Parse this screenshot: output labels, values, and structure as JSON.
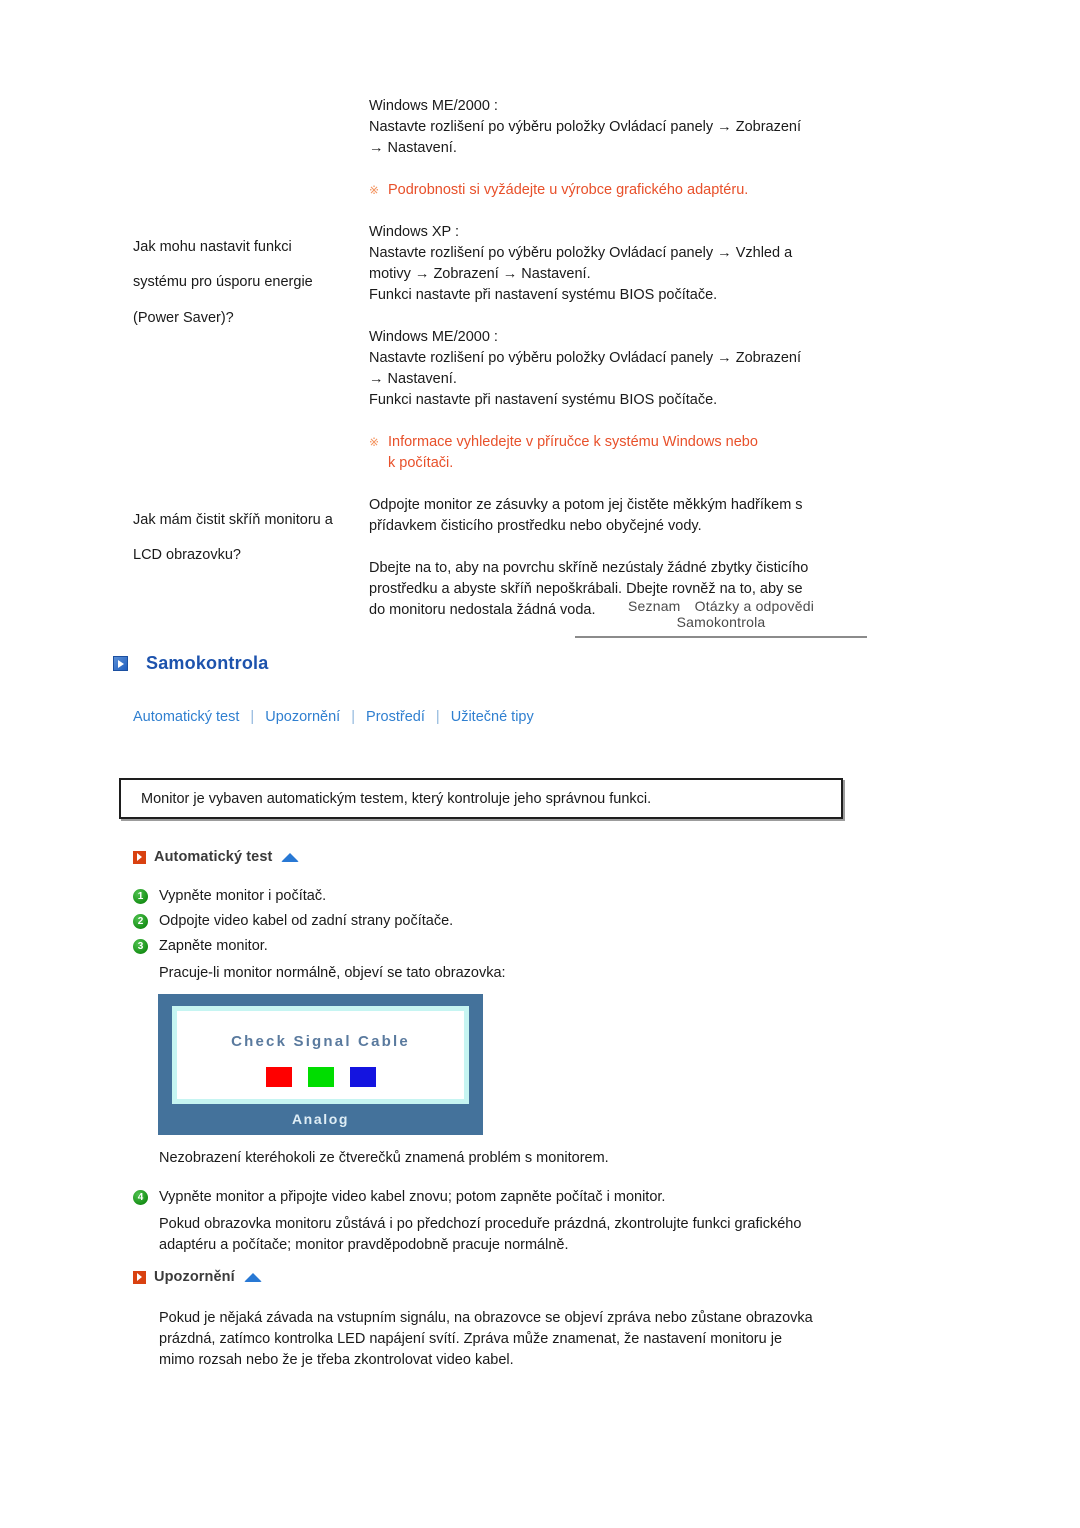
{
  "faq": {
    "rows": [
      {
        "question": "",
        "answer_blocks": [
          {
            "type": "text",
            "lines": [
              "Windows ME/2000 :",
              "Nastavte rozlišení po výběru položky Ovládací panely → Zobrazení",
              "→ Nastavení."
            ]
          },
          {
            "type": "note",
            "mark": "※",
            "lines": [
              "Podrobnosti si vyžádejte u výrobce grafického adaptéru."
            ]
          }
        ]
      },
      {
        "question": "Jak mohu nastavit funkci systému pro úsporu energie (Power Saver)?",
        "question_lines": [
          "Jak mohu nastavit funkci",
          "systému pro úsporu energie",
          "(Power Saver)?"
        ],
        "answer_blocks": [
          {
            "type": "text",
            "lines": [
              "Windows XP :",
              "Nastavte rozlišení po výběru položky Ovládací panely → Vzhled a",
              "motivy → Zobrazení → Nastavení.",
              "Funkci nastavte při nastavení systému BIOS počítače."
            ]
          },
          {
            "type": "text",
            "lines": [
              "Windows ME/2000 :",
              "Nastavte rozlišení po výběru položky Ovládací panely → Zobrazení",
              "→ Nastavení.",
              "Funkci nastavte při nastavení systému BIOS počítače."
            ]
          },
          {
            "type": "note",
            "mark": "※",
            "lines": [
              "Informace vyhledejte v příručce k systému Windows nebo",
              "k počítači."
            ]
          }
        ]
      },
      {
        "question": "Jak mám čistit skříň monitoru a LCD obrazovku?",
        "question_lines": [
          "Jak mám čistit skříň monitoru a",
          "LCD obrazovku?"
        ],
        "answer_blocks": [
          {
            "type": "text",
            "lines": [
              "Odpojte monitor ze zásuvky a potom jej čistěte měkkým hadříkem s",
              "přídavkem čisticího prostředku nebo obyčejné vody."
            ]
          },
          {
            "type": "text",
            "lines": [
              "Dbejte na to, aby na povrchu skříně nezústaly žádné zbytky čisticího",
              "prostředku a abyste skříň nepoškrábali. Dbejte rovněž na to, aby se",
              "do monitoru nedostala žádná voda."
            ]
          }
        ]
      }
    ]
  },
  "breadcrumb": {
    "items": [
      "Seznam",
      "Otázky a odpovědi",
      "Samokontrola"
    ]
  },
  "section": {
    "title": "Samokontrola",
    "links": [
      "Automatický test",
      "Upozornění",
      "Prostředí",
      "Užitečné tipy"
    ],
    "link_separator": "|"
  },
  "intro": {
    "text": "Monitor je vybaven automatickým testem, který kontroluje jeho správnou funkci."
  },
  "selftest": {
    "heading": "Automatický test",
    "steps": [
      {
        "num": "1",
        "text": "Vypněte monitor i počítač."
      },
      {
        "num": "2",
        "text": "Odpojte video kabel od zadní strany počítače."
      },
      {
        "num": "3",
        "text": "Zapněte monitor."
      }
    ],
    "after_steps_text": "Pracuje-li monitor normálně, objeví se tato obrazovka:",
    "below_image_text": "Nezobrazení kteréhokoli ze čtverečků znamená problém s monitorem.",
    "step4": {
      "num": "4",
      "text": "Vypněte monitor a připojte video kabel znovu; potom zapněte počítač i monitor."
    },
    "step4_note_lines": [
      "Pokud obrazovka monitoru zůstává i po předchozí proceduře prázdná, zkontrolujte funkci grafického",
      "adaptéru a počítače; monitor pravděpodobně pracuje normálně."
    ]
  },
  "monitor_graphic": {
    "screen_text": "Check Signal Cable",
    "label": "Analog",
    "swatch_colors": [
      "#ff0000",
      "#00dd00",
      "#1414e0"
    ],
    "frame_color": "#44729b",
    "inner_border_color": "#c6f5f2"
  },
  "warning": {
    "heading": "Upozornění",
    "lines": [
      "Pokud je nějaká závada na vstupním signálu, na obrazovce se objeví zpráva nebo zůstane obrazovka",
      "prázdná, zatímco kontrolka LED napájení svítí. Zpráva může znamenat, že nastavení monitoru je",
      "mimo rozsah nebo že je třeba zkontrolovat video kabel."
    ]
  },
  "colors": {
    "link_blue": "#2f7fd0",
    "heading_blue": "#1d53ad",
    "note_orange": "#e8502a",
    "bullet_orange": "#d94110",
    "bullet_green": "#179017"
  }
}
